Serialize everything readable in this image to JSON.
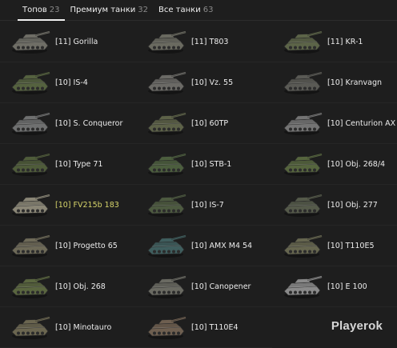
{
  "tabs": [
    {
      "label": "Топов",
      "count": "23"
    },
    {
      "label": "Премиум танки",
      "count": "32"
    },
    {
      "label": "Все танки",
      "count": "63"
    }
  ],
  "tanks": [
    {
      "name": "[11] Gorilla",
      "icon": "tank-icon",
      "color": "#6f6e66"
    },
    {
      "name": "[11] T803",
      "icon": "tank-icon",
      "color": "#6a6a60"
    },
    {
      "name": "[11] KR-1",
      "icon": "tank-icon",
      "color": "#5c6448"
    },
    {
      "name": "[10] IS-4",
      "icon": "tank-icon",
      "color": "#55623f"
    },
    {
      "name": "[10] Vz. 55",
      "icon": "tank-icon",
      "color": "#6b6a66"
    },
    {
      "name": "[10] Kranvagn",
      "icon": "tank-icon",
      "color": "#5a5a55"
    },
    {
      "name": "[10] S. Conqueror",
      "icon": "tank-icon",
      "color": "#6f7070"
    },
    {
      "name": "[10] 60TP",
      "icon": "tank-icon",
      "color": "#5d6248"
    },
    {
      "name": "[10] Centurion AX",
      "icon": "tank-icon",
      "color": "#747474"
    },
    {
      "name": "[10] Type 71",
      "icon": "tank-icon",
      "color": "#4f5c3a"
    },
    {
      "name": "[10] STB-1",
      "icon": "tank-icon",
      "color": "#4c5e3e"
    },
    {
      "name": "[10] Obj. 268/4",
      "icon": "tank-icon",
      "color": "#56653e"
    },
    {
      "name": "[10] FV215b 183",
      "icon": "tank-icon",
      "color": "#8a8676",
      "premium": true
    },
    {
      "name": "[10] IS-7",
      "icon": "tank-icon",
      "color": "#4d5a40"
    },
    {
      "name": "[10] Obj. 277",
      "icon": "tank-icon",
      "color": "#555a4a"
    },
    {
      "name": "[10] Progetto 65",
      "icon": "tank-icon",
      "color": "#6e6a58"
    },
    {
      "name": "[10] AMX M4 54",
      "icon": "tank-icon",
      "color": "#3f5e5e"
    },
    {
      "name": "[10] T110E5",
      "icon": "tank-icon",
      "color": "#66664f"
    },
    {
      "name": "[10] Obj. 268",
      "icon": "tank-icon",
      "color": "#5a663f"
    },
    {
      "name": "[10] Canopener",
      "icon": "tank-icon",
      "color": "#6a6a62"
    },
    {
      "name": "[10] E 100",
      "icon": "tank-icon",
      "color": "#8a8a8a"
    },
    {
      "name": "[10] Minotauro",
      "icon": "tank-icon",
      "color": "#6b6650"
    },
    {
      "name": "[10] T110E4",
      "icon": "tank-icon",
      "color": "#6e5f50"
    }
  ],
  "brand": "Playerok"
}
